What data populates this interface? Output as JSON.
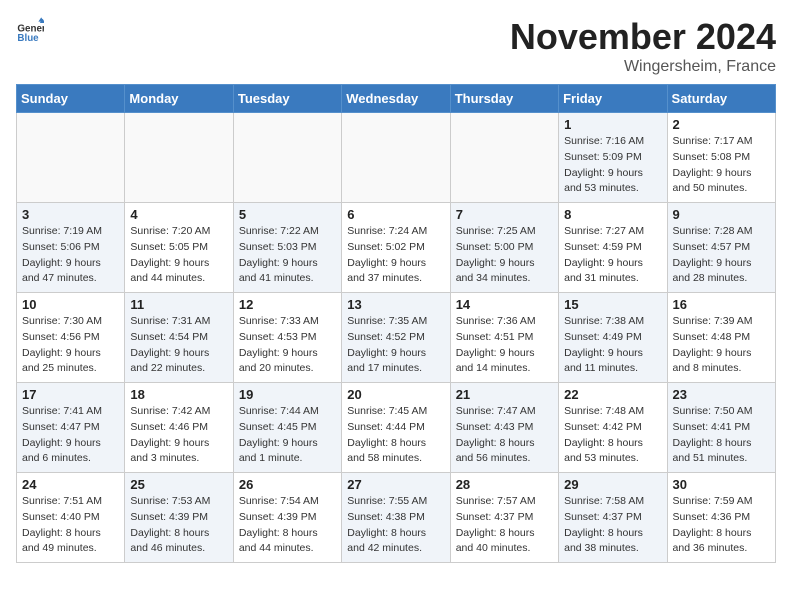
{
  "header": {
    "logo_general": "General",
    "logo_blue": "Blue",
    "month_title": "November 2024",
    "location": "Wingersheim, France"
  },
  "days_of_week": [
    "Sunday",
    "Monday",
    "Tuesday",
    "Wednesday",
    "Thursday",
    "Friday",
    "Saturday"
  ],
  "weeks": [
    [
      {
        "day": "",
        "info": "",
        "empty": true
      },
      {
        "day": "",
        "info": "",
        "empty": true
      },
      {
        "day": "",
        "info": "",
        "empty": true
      },
      {
        "day": "",
        "info": "",
        "empty": true
      },
      {
        "day": "",
        "info": "",
        "empty": true
      },
      {
        "day": "1",
        "info": "Sunrise: 7:16 AM\nSunset: 5:09 PM\nDaylight: 9 hours and 53 minutes.",
        "shaded": true
      },
      {
        "day": "2",
        "info": "Sunrise: 7:17 AM\nSunset: 5:08 PM\nDaylight: 9 hours and 50 minutes.",
        "shaded": false
      }
    ],
    [
      {
        "day": "3",
        "info": "Sunrise: 7:19 AM\nSunset: 5:06 PM\nDaylight: 9 hours and 47 minutes.",
        "shaded": true
      },
      {
        "day": "4",
        "info": "Sunrise: 7:20 AM\nSunset: 5:05 PM\nDaylight: 9 hours and 44 minutes.",
        "shaded": false
      },
      {
        "day": "5",
        "info": "Sunrise: 7:22 AM\nSunset: 5:03 PM\nDaylight: 9 hours and 41 minutes.",
        "shaded": true
      },
      {
        "day": "6",
        "info": "Sunrise: 7:24 AM\nSunset: 5:02 PM\nDaylight: 9 hours and 37 minutes.",
        "shaded": false
      },
      {
        "day": "7",
        "info": "Sunrise: 7:25 AM\nSunset: 5:00 PM\nDaylight: 9 hours and 34 minutes.",
        "shaded": true
      },
      {
        "day": "8",
        "info": "Sunrise: 7:27 AM\nSunset: 4:59 PM\nDaylight: 9 hours and 31 minutes.",
        "shaded": false
      },
      {
        "day": "9",
        "info": "Sunrise: 7:28 AM\nSunset: 4:57 PM\nDaylight: 9 hours and 28 minutes.",
        "shaded": true
      }
    ],
    [
      {
        "day": "10",
        "info": "Sunrise: 7:30 AM\nSunset: 4:56 PM\nDaylight: 9 hours and 25 minutes.",
        "shaded": false
      },
      {
        "day": "11",
        "info": "Sunrise: 7:31 AM\nSunset: 4:54 PM\nDaylight: 9 hours and 22 minutes.",
        "shaded": true
      },
      {
        "day": "12",
        "info": "Sunrise: 7:33 AM\nSunset: 4:53 PM\nDaylight: 9 hours and 20 minutes.",
        "shaded": false
      },
      {
        "day": "13",
        "info": "Sunrise: 7:35 AM\nSunset: 4:52 PM\nDaylight: 9 hours and 17 minutes.",
        "shaded": true
      },
      {
        "day": "14",
        "info": "Sunrise: 7:36 AM\nSunset: 4:51 PM\nDaylight: 9 hours and 14 minutes.",
        "shaded": false
      },
      {
        "day": "15",
        "info": "Sunrise: 7:38 AM\nSunset: 4:49 PM\nDaylight: 9 hours and 11 minutes.",
        "shaded": true
      },
      {
        "day": "16",
        "info": "Sunrise: 7:39 AM\nSunset: 4:48 PM\nDaylight: 9 hours and 8 minutes.",
        "shaded": false
      }
    ],
    [
      {
        "day": "17",
        "info": "Sunrise: 7:41 AM\nSunset: 4:47 PM\nDaylight: 9 hours and 6 minutes.",
        "shaded": true
      },
      {
        "day": "18",
        "info": "Sunrise: 7:42 AM\nSunset: 4:46 PM\nDaylight: 9 hours and 3 minutes.",
        "shaded": false
      },
      {
        "day": "19",
        "info": "Sunrise: 7:44 AM\nSunset: 4:45 PM\nDaylight: 9 hours and 1 minute.",
        "shaded": true
      },
      {
        "day": "20",
        "info": "Sunrise: 7:45 AM\nSunset: 4:44 PM\nDaylight: 8 hours and 58 minutes.",
        "shaded": false
      },
      {
        "day": "21",
        "info": "Sunrise: 7:47 AM\nSunset: 4:43 PM\nDaylight: 8 hours and 56 minutes.",
        "shaded": true
      },
      {
        "day": "22",
        "info": "Sunrise: 7:48 AM\nSunset: 4:42 PM\nDaylight: 8 hours and 53 minutes.",
        "shaded": false
      },
      {
        "day": "23",
        "info": "Sunrise: 7:50 AM\nSunset: 4:41 PM\nDaylight: 8 hours and 51 minutes.",
        "shaded": true
      }
    ],
    [
      {
        "day": "24",
        "info": "Sunrise: 7:51 AM\nSunset: 4:40 PM\nDaylight: 8 hours and 49 minutes.",
        "shaded": false
      },
      {
        "day": "25",
        "info": "Sunrise: 7:53 AM\nSunset: 4:39 PM\nDaylight: 8 hours and 46 minutes.",
        "shaded": true
      },
      {
        "day": "26",
        "info": "Sunrise: 7:54 AM\nSunset: 4:39 PM\nDaylight: 8 hours and 44 minutes.",
        "shaded": false
      },
      {
        "day": "27",
        "info": "Sunrise: 7:55 AM\nSunset: 4:38 PM\nDaylight: 8 hours and 42 minutes.",
        "shaded": true
      },
      {
        "day": "28",
        "info": "Sunrise: 7:57 AM\nSunset: 4:37 PM\nDaylight: 8 hours and 40 minutes.",
        "shaded": false
      },
      {
        "day": "29",
        "info": "Sunrise: 7:58 AM\nSunset: 4:37 PM\nDaylight: 8 hours and 38 minutes.",
        "shaded": true
      },
      {
        "day": "30",
        "info": "Sunrise: 7:59 AM\nSunset: 4:36 PM\nDaylight: 8 hours and 36 minutes.",
        "shaded": false
      }
    ]
  ]
}
